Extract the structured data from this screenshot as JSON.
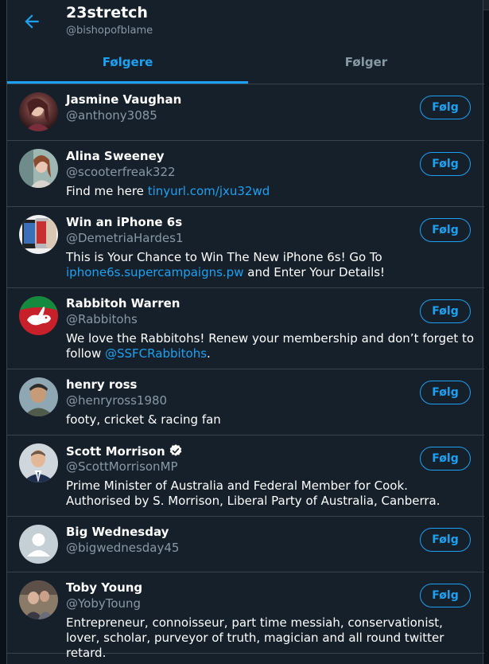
{
  "profile": {
    "name": "23stretch",
    "handle": "@bishopofblame"
  },
  "tabs": [
    {
      "label": "Følgere",
      "active": true
    },
    {
      "label": "Følger",
      "active": false
    }
  ],
  "colors": {
    "accent": "#1da1f2",
    "background": "#15202b",
    "secondary_text": "#8899a6",
    "border": "#38444d"
  },
  "users": [
    {
      "name": "Jasmine Vaughan",
      "handle": "@anthony3085",
      "follow_label": "Følg",
      "bio_pre": "",
      "bio_link": "",
      "bio_post": "",
      "verified": false,
      "avatar_icon": "portrait-photo-icon"
    },
    {
      "name": "Alina Sweeney",
      "handle": "@scooterfreak322",
      "follow_label": "Følg",
      "bio_pre": "Find me here ",
      "bio_link": "tinyurl.com/jxu32wd",
      "bio_post": "",
      "verified": false,
      "avatar_icon": "portrait-photo-icon"
    },
    {
      "name": "Win an iPhone 6s",
      "handle": "@DemetriaHardes1",
      "follow_label": "Følg",
      "bio_pre": "This is Your Chance to Win The New iPhone 6s! Go To ",
      "bio_link": "iphone6s.supercampaigns.pw",
      "bio_post": " and Enter Your Details!",
      "verified": false,
      "avatar_icon": "iphone-photo-icon"
    },
    {
      "name": "Rabbitoh Warren",
      "handle": "@Rabbitohs",
      "follow_label": "Følg",
      "bio_pre": "We love the Rabbitohs! Renew your membership and don’t forget to follow ",
      "bio_link": "@SSFCRabbitohs",
      "bio_post": ".",
      "verified": false,
      "avatar_icon": "rabbit-logo-icon"
    },
    {
      "name": "henry ross",
      "handle": "@henryross1980",
      "follow_label": "Følg",
      "bio_pre": "footy, cricket & racing fan",
      "bio_link": "",
      "bio_post": "",
      "verified": false,
      "avatar_icon": "portrait-photo-icon"
    },
    {
      "name": "Scott Morrison",
      "handle": "@ScottMorrisonMP",
      "follow_label": "Følg",
      "bio_pre": "Prime Minister of Australia and Federal Member for Cook. Authorised by S. Morrison, Liberal Party of Australia, Canberra.",
      "bio_link": "",
      "bio_post": "",
      "verified": true,
      "avatar_icon": "portrait-photo-icon"
    },
    {
      "name": "Big Wednesday",
      "handle": "@bigwednesday45",
      "follow_label": "Følg",
      "bio_pre": "",
      "bio_link": "",
      "bio_post": "",
      "verified": false,
      "avatar_icon": "default-avatar-icon"
    },
    {
      "name": "Toby Young",
      "handle": "@YobyToung",
      "follow_label": "Følg",
      "bio_pre": "Entrepreneur, connoisseur, part time messiah, conservationist, lover, scholar, purveyor of truth, magician and all round twitter retard.",
      "bio_link": "",
      "bio_post": "",
      "verified": false,
      "avatar_icon": "portrait-photo-icon"
    }
  ]
}
